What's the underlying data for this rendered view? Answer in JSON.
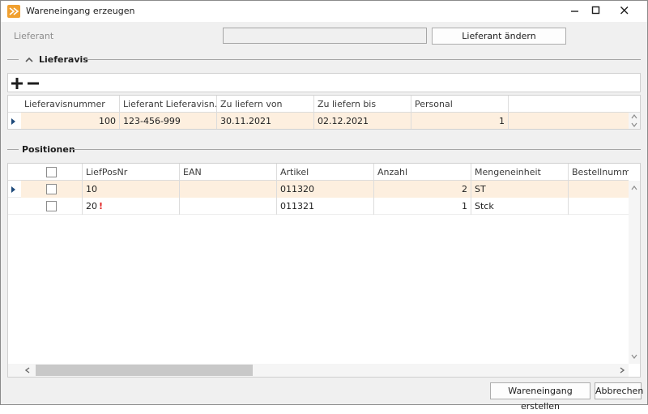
{
  "window": {
    "title": "Wareneingang erzeugen"
  },
  "supplier": {
    "label": "Lieferant",
    "value": "",
    "change_button": "Lieferant ändern"
  },
  "lieferavis": {
    "section_title": "Lieferavis",
    "columns": [
      "Lieferavisnummer",
      "Lieferant Lieferavisn...",
      "Zu liefern von",
      "Zu liefern bis",
      "Personal"
    ],
    "rows": [
      [
        "100",
        "123-456-999",
        "30.11.2021",
        "02.12.2021",
        "1"
      ]
    ]
  },
  "positionen": {
    "section_title": "Positionen",
    "columns": [
      "",
      "LiefPosNr",
      "EAN",
      "Artikel",
      "Anzahl",
      "Mengeneinheit",
      "Bestellnumme"
    ],
    "rows": [
      [
        "",
        "10",
        "",
        "011320",
        "2",
        "ST",
        ""
      ],
      [
        "",
        "20",
        "",
        "011321",
        "1",
        "Stck",
        ""
      ]
    ],
    "warning_mark": "!"
  },
  "footer": {
    "create_button": "Wareneingang erstellen",
    "cancel_button": "Abbrechen"
  },
  "colors": {
    "selected_row": "#fdefdf",
    "app_icon": "#f0a030",
    "warning": "#e02020"
  }
}
